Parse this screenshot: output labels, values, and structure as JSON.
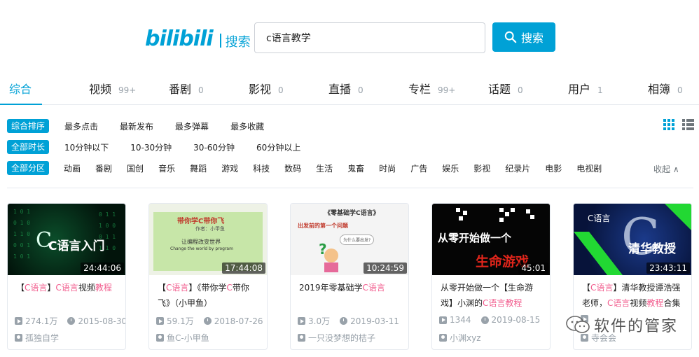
{
  "brand": {
    "logo": "bilibili",
    "sub": "搜索"
  },
  "search": {
    "value": "c语言教学",
    "button_label": "搜索"
  },
  "tabs": [
    {
      "label": "综合",
      "count": ""
    },
    {
      "label": "视频",
      "count": "99+"
    },
    {
      "label": "番剧",
      "count": "0"
    },
    {
      "label": "影视",
      "count": "0"
    },
    {
      "label": "直播",
      "count": "0"
    },
    {
      "label": "专栏",
      "count": "99+"
    },
    {
      "label": "话题",
      "count": "0"
    },
    {
      "label": "用户",
      "count": "1"
    },
    {
      "label": "相簿",
      "count": "0"
    }
  ],
  "filters": {
    "sort": {
      "tag": "综合排序",
      "options": [
        "最多点击",
        "最新发布",
        "最多弹幕",
        "最多收藏"
      ]
    },
    "duration": {
      "tag": "全部时长",
      "options": [
        "10分钟以下",
        "10-30分钟",
        "30-60分钟",
        "60分钟以上"
      ]
    },
    "zone": {
      "tag": "全部分区",
      "options": [
        "动画",
        "番剧",
        "国创",
        "音乐",
        "舞蹈",
        "游戏",
        "科技",
        "数码",
        "生活",
        "鬼畜",
        "时尚",
        "广告",
        "娱乐",
        "影视",
        "纪录片",
        "电影",
        "电视剧"
      ]
    },
    "collapse": "收起"
  },
  "videos": [
    {
      "duration": "24:44:06",
      "title_parts": [
        {
          "t": "【",
          "h": false
        },
        {
          "t": "C语言",
          "h": true
        },
        {
          "t": "】",
          "h": false
        },
        {
          "t": "C语言",
          "h": true
        },
        {
          "t": "视频",
          "h": false
        },
        {
          "t": "教程",
          "h": true
        }
      ],
      "views": "274.1万",
      "date": "2015-08-30",
      "author": "孤独自学",
      "thumb_text": "C语言入门"
    },
    {
      "duration": "17:44:08",
      "title_parts": [
        {
          "t": "【",
          "h": false
        },
        {
          "t": "C语言",
          "h": true
        },
        {
          "t": "】《带你学",
          "h": false
        },
        {
          "t": "C",
          "h": true
        },
        {
          "t": "带你飞》（小甲鱼）",
          "h": false
        }
      ],
      "views": "59.1万",
      "date": "2018-07-26",
      "author": "鱼C-小甲鱼",
      "thumb_text": "带你学C带你飞",
      "thumb_text2": "作者：小甲鱼",
      "thumb_text3": "让编程改变世界",
      "thumb_text4": "Change the world by program"
    },
    {
      "duration": "10:24:59",
      "title_parts": [
        {
          "t": "2019年零基础学",
          "h": false
        },
        {
          "t": "C语言",
          "h": true
        }
      ],
      "views": "3.0万",
      "date": "2019-03-11",
      "author": "一只没梦想的桔子",
      "thumb_text": "《零基础学C语言》",
      "thumb_text2": "出发前的第一个问题",
      "thumb_text3": "为什么要出发?"
    },
    {
      "duration": "45:01",
      "title_parts": [
        {
          "t": "从零开始做一个【生命游戏】小渊的",
          "h": false
        },
        {
          "t": "C语言",
          "h": true
        },
        {
          "t": "教程",
          "h": true
        }
      ],
      "views": "1344",
      "date": "2019-08-15",
      "author": "小渊xyz",
      "thumb_text": "从零开始做一个",
      "thumb_text2": "生命游戏"
    },
    {
      "duration": "23:43:11",
      "title_parts": [
        {
          "t": "【",
          "h": false
        },
        {
          "t": "C语言",
          "h": true
        },
        {
          "t": "】清华教授谭浩强老师，",
          "h": false
        },
        {
          "t": "C语言",
          "h": true
        },
        {
          "t": "视频",
          "h": false
        },
        {
          "t": "教程",
          "h": true
        },
        {
          "t": "合集",
          "h": false
        }
      ],
      "views": "",
      "date": "",
      "author": "寺会会",
      "thumb_text": "C语言",
      "thumb_text2": "清华教授"
    }
  ],
  "watermark": "软件的管家",
  "colors": {
    "accent": "#00a1d6",
    "highlight": "#f25d8e",
    "muted": "#99a2aa"
  }
}
